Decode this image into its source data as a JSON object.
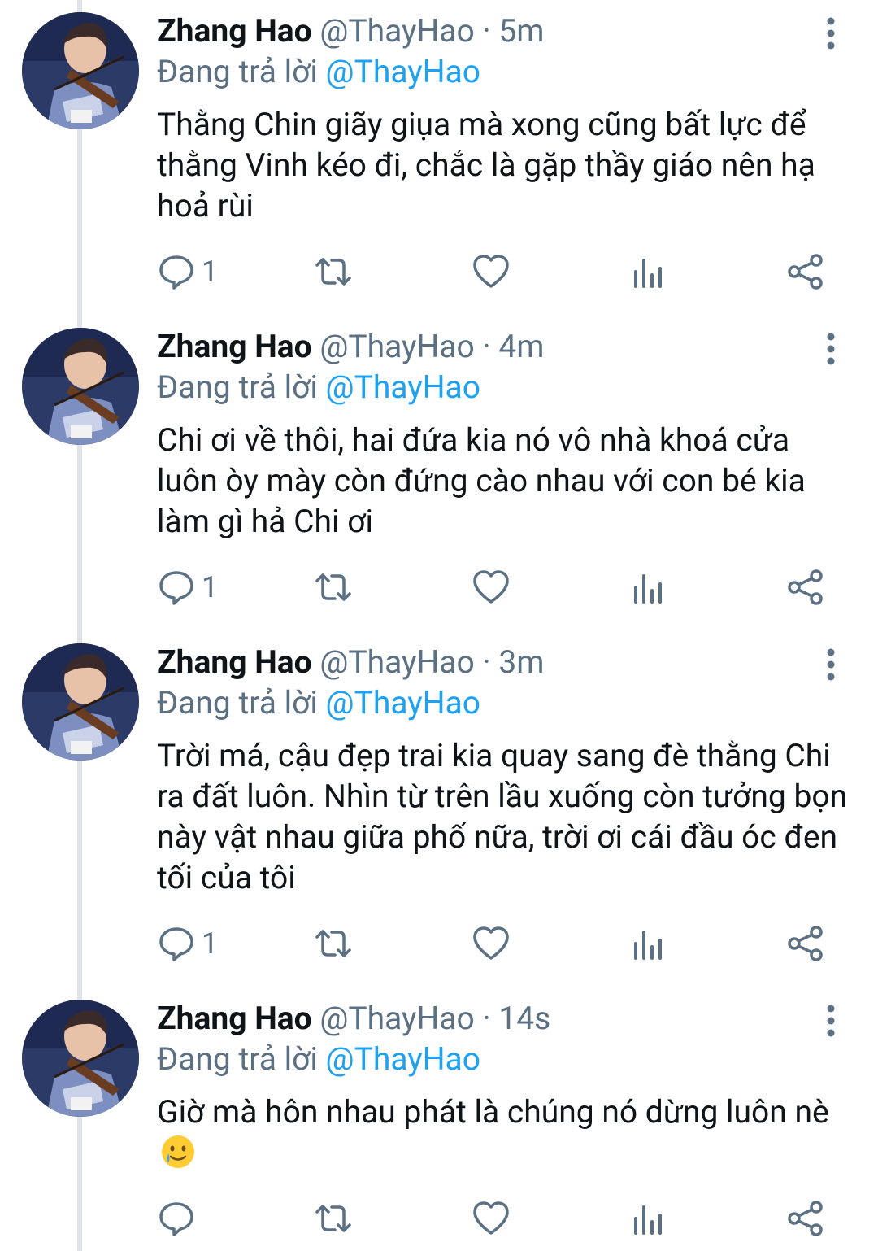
{
  "colors": {
    "text": "#0f1419",
    "secondary": "#5b7083",
    "link": "#1da1f2",
    "thread_line": "#e1e4e7"
  },
  "tweets": [
    {
      "name": "Zhang Hao",
      "handle": "@ThayHao",
      "separator": "·",
      "time": "5m",
      "reply_label": "Đang trả lời",
      "reply_mention": "@ThayHao",
      "text": "Thằng Chin giãy giụa mà xong cũng bất lực để thằng Vinh kéo đi, chắc là gặp thầy giáo nên hạ hoả rùi",
      "reply_count": "1"
    },
    {
      "name": "Zhang Hao",
      "handle": "@ThayHao",
      "separator": "·",
      "time": "4m",
      "reply_label": "Đang trả lời",
      "reply_mention": "@ThayHao",
      "text": "Chi ơi về thôi, hai đứa kia nó vô nhà khoá cửa luôn òy mày còn đứng cào nhau với con bé kia làm gì hả Chi ơi",
      "reply_count": "1"
    },
    {
      "name": "Zhang Hao",
      "handle": "@ThayHao",
      "separator": "·",
      "time": "3m",
      "reply_label": "Đang trả lời",
      "reply_mention": "@ThayHao",
      "text": "Trời má, cậu đẹp trai kia quay sang đè thằng Chi ra đất luôn. Nhìn từ trên lầu xuống còn tưởng bọn này vật nhau giữa phố nữa, trời ơi cái đầu óc đen tối của tôi",
      "reply_count": "1"
    },
    {
      "name": "Zhang Hao",
      "handle": "@ThayHao",
      "separator": "·",
      "time": "14s",
      "reply_label": "Đang trả lời",
      "reply_mention": "@ThayHao",
      "text": "Giờ mà hôn nhau phát là chúng nó dừng luôn nè",
      "emoji": "smiling-face-with-tear-emoji",
      "reply_count": ""
    }
  ],
  "icons": {
    "reply": "reply-icon",
    "retweet": "retweet-icon",
    "like": "like-icon",
    "analytics": "analytics-icon",
    "share": "share-icon",
    "menu": "more-vertical-icon"
  }
}
